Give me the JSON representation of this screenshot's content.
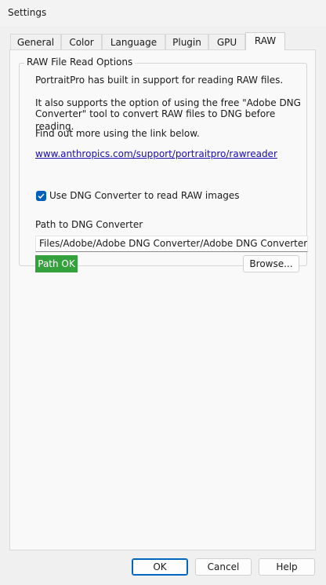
{
  "window": {
    "title": "Settings"
  },
  "tabs": [
    {
      "label": "General"
    },
    {
      "label": "Color"
    },
    {
      "label": "Language"
    },
    {
      "label": "Plugin"
    },
    {
      "label": "GPU"
    },
    {
      "label": "RAW",
      "active": true
    }
  ],
  "raw": {
    "group_title": "RAW File Read Options",
    "line1": "PortraitPro has built in support for reading RAW files.",
    "line2a": "It also supports the option of using the free \"Adobe DNG",
    "line2b": "Converter\" tool to convert RAW files to DNG before reading.",
    "line3": "Find out more using the link below.",
    "link": "www.anthropics.com/support/portraitpro/rawreader",
    "checkbox_label": "Use DNG Converter to read RAW images",
    "checkbox_checked": true,
    "path_label": "Path to DNG Converter",
    "path_value": "Files/Adobe/Adobe DNG Converter/Adobe DNG Converter.exe",
    "path_status": "Path OK",
    "browse_label": "Browse..."
  },
  "footer": {
    "ok_label": "OK",
    "cancel_label": "Cancel",
    "help_label": "Help"
  },
  "colors": {
    "accent": "#005fb8",
    "status_ok": "#34a13d",
    "link": "#1a0dab"
  }
}
